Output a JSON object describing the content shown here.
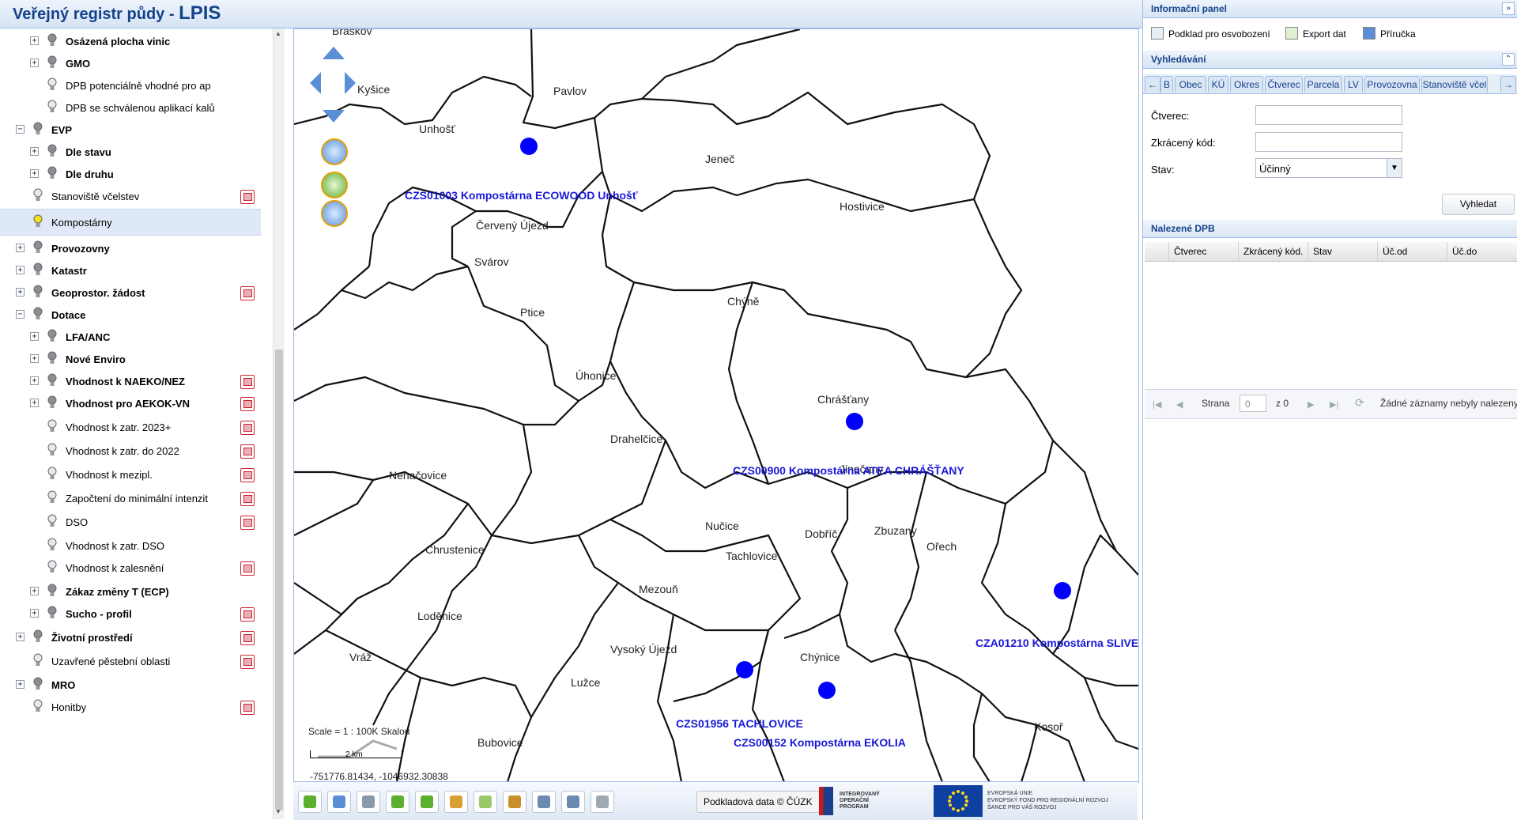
{
  "app": {
    "title_prefix": "Veřejný registr půdy - ",
    "title_brand": "LPIS"
  },
  "layer_tree": [
    {
      "label": "Osázená plocha vinic",
      "bold": true,
      "indent": 1,
      "expander": "+",
      "legend": false
    },
    {
      "label": "GMO",
      "bold": true,
      "indent": 1,
      "expander": "+",
      "legend": false
    },
    {
      "label": "DPB potenciálně vhodné pro ap",
      "bold": false,
      "indent": 1,
      "expander": "",
      "legend": false
    },
    {
      "label": "DPB se schválenou aplikací kalů",
      "bold": false,
      "indent": 1,
      "expander": "",
      "legend": false
    },
    {
      "label": "EVP",
      "bold": true,
      "indent": 0,
      "expander": "−",
      "legend": false
    },
    {
      "label": "Dle stavu",
      "bold": true,
      "indent": 1,
      "expander": "+",
      "legend": false
    },
    {
      "label": "Dle druhu",
      "bold": true,
      "indent": 1,
      "expander": "+",
      "legend": false
    },
    {
      "label": "Stanoviště včelstev",
      "bold": false,
      "indent": 0,
      "expander": "",
      "legend": true
    },
    {
      "label": "Kompostárny",
      "bold": false,
      "indent": 0,
      "expander": "",
      "legend": false,
      "selected": true,
      "active": true
    },
    {
      "label": "Provozovny",
      "bold": true,
      "indent": 0,
      "expander": "+",
      "legend": false
    },
    {
      "label": "Katastr",
      "bold": true,
      "indent": 0,
      "expander": "+",
      "legend": false
    },
    {
      "label": "Geoprostor. žádost",
      "bold": true,
      "indent": 0,
      "expander": "+",
      "legend": true
    },
    {
      "label": "Dotace",
      "bold": true,
      "indent": 0,
      "expander": "−",
      "legend": false
    },
    {
      "label": "LFA/ANC",
      "bold": true,
      "indent": 1,
      "expander": "+",
      "legend": false
    },
    {
      "label": "Nové Enviro",
      "bold": true,
      "indent": 1,
      "expander": "+",
      "legend": false
    },
    {
      "label": "Vhodnost k NAEKO/NEZ",
      "bold": true,
      "indent": 1,
      "expander": "+",
      "legend": true
    },
    {
      "label": "Vhodnost pro AEKOK-VN",
      "bold": true,
      "indent": 1,
      "expander": "+",
      "legend": true
    },
    {
      "label": "Vhodnost k zatr. 2023+",
      "bold": false,
      "indent": 1,
      "expander": "",
      "legend": true
    },
    {
      "label": "Vhodnost k zatr. do 2022",
      "bold": false,
      "indent": 1,
      "expander": "",
      "legend": true
    },
    {
      "label": "Vhodnost k mezipl.",
      "bold": false,
      "indent": 1,
      "expander": "",
      "legend": true
    },
    {
      "label": "Započtení do minimální intenzit",
      "bold": false,
      "indent": 1,
      "expander": "",
      "legend": true
    },
    {
      "label": "DSO",
      "bold": false,
      "indent": 1,
      "expander": "",
      "legend": true
    },
    {
      "label": "Vhodnost k zatr. DSO",
      "bold": false,
      "indent": 1,
      "expander": "",
      "legend": false
    },
    {
      "label": "Vhodnost k zalesnění",
      "bold": false,
      "indent": 1,
      "expander": "",
      "legend": true
    },
    {
      "label": "Zákaz změny T (ECP)",
      "bold": true,
      "indent": 1,
      "expander": "+",
      "legend": false
    },
    {
      "label": "Sucho - profil",
      "bold": true,
      "indent": 1,
      "expander": "+",
      "legend": true
    },
    {
      "label": "Životní prostředí",
      "bold": true,
      "indent": 0,
      "expander": "+",
      "legend": true
    },
    {
      "label": "Uzavřené pěstební oblasti",
      "bold": false,
      "indent": 0,
      "expander": "",
      "legend": true
    },
    {
      "label": "MRO",
      "bold": true,
      "indent": 0,
      "expander": "+",
      "legend": false
    },
    {
      "label": "Honitby",
      "bold": false,
      "indent": 0,
      "expander": "",
      "legend": true
    }
  ],
  "map": {
    "towns": [
      "Braškov",
      "Kyšice",
      "Pavlov",
      "Unhošť",
      "Jeneč",
      "Hostivice",
      "Červený Újezd",
      "Svárov",
      "Chýně",
      "Ptice",
      "Úhonice",
      "Chrášťany",
      "Drahelčice",
      "Jinočany",
      "Nenačovice",
      "Nučice",
      "Dobříč",
      "Zbuzany",
      "Ořech",
      "Tachlovice",
      "Chrustenice",
      "Mezouň",
      "Loděnice",
      "Vysoký Újezd",
      "Chýnice",
      "Vráž",
      "Lužce",
      "Bubovice",
      "Kosoř"
    ],
    "sites": [
      "CZS01003 Kompostárna ECOWOOD Unhošť",
      "CZS00900 Kompostárna ATEA CHRÁŠŤANY",
      "CZA01210 Kompostárna SLIVE",
      "CZS01956 TACHLOVICE",
      "CZS00152 Kompostárna EKOLIA"
    ],
    "site_color": "#0000ff",
    "scale_text": "Scale = 1 : 100K Skalou",
    "scale_km": "2 km",
    "coords": "-751776.81434, -1046932.30838"
  },
  "toolbar": {
    "buttons": [
      "refresh-icon",
      "full-extent-icon",
      "zoom-extent-icon",
      "back-icon",
      "forward-icon",
      "measure-icon",
      "identify-icon",
      "clear-icon",
      "print-preview-icon",
      "print-icon",
      "settings-icon"
    ],
    "cuzk_label": "Podkladová data © ČÚZK",
    "iop_lines": [
      "INTEGROVANÝ",
      "OPERAČNÍ",
      "PROGRAM"
    ],
    "eu_lines": [
      "EVROPSKÁ UNIE",
      "EVROPSKÝ FOND PRO REGIONÁLNÍ ROZVOJ",
      "ŠANCE PRO VÁŠ ROZVOJ"
    ]
  },
  "right_panel": {
    "info_title": "Informační panel",
    "tools": [
      "Podklad pro osvobození",
      "Export dat",
      "Příručka"
    ],
    "search_title": "Vyhledávání",
    "tabs": [
      "B",
      "Obec",
      "KÚ",
      "Okres",
      "Čtverec",
      "Parcela",
      "LV",
      "Provozovna",
      "Stanoviště včel"
    ],
    "fields": {
      "ctverec_label": "Čtverec:",
      "ctverec_value": "",
      "kod_label": "Zkrácený kód:",
      "kod_value": "",
      "stav_label": "Stav:",
      "stav_value": "Účinný"
    },
    "search_button": "Vyhledat",
    "results_title": "Nalezené DPB",
    "columns": [
      "Čtverec",
      "Zkrácený kód.",
      "Stav",
      "Úč.od",
      "Úč.do"
    ],
    "pager": {
      "page_label": "Strana",
      "page_value": "0",
      "of_label": "z 0",
      "empty_msg": "Žádné záznamy nebyly nalezeny"
    }
  }
}
